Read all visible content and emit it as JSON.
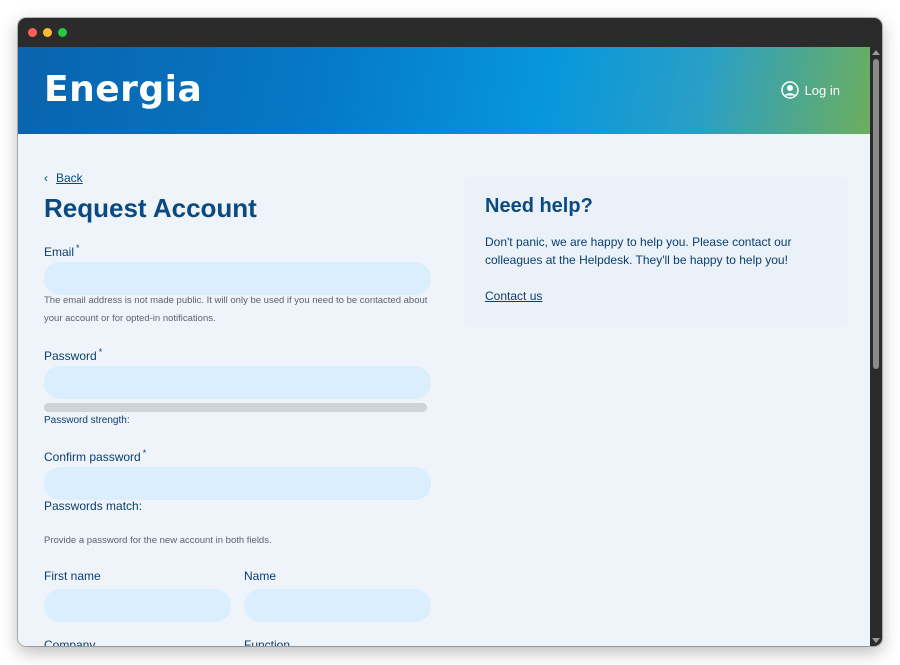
{
  "header": {
    "logo_text": "Energia",
    "login_label": "Log in"
  },
  "nav": {
    "back_label": "Back"
  },
  "page": {
    "title": "Request Account"
  },
  "form": {
    "email": {
      "label": "Email",
      "required_mark": "*",
      "value": "",
      "help": "The email address is not made public. It will only be used if you need to be contacted about your account or for opted-in notifications."
    },
    "password": {
      "label": "Password",
      "required_mark": "*",
      "value": "",
      "strength_label": "Password strength:"
    },
    "confirm_password": {
      "label": "Confirm password",
      "required_mark": "*",
      "value": "",
      "match_label": "Passwords match:",
      "help": "Provide a password for the new account in both fields."
    },
    "first_name": {
      "label": "First name",
      "value": ""
    },
    "name": {
      "label": "Name",
      "value": ""
    },
    "company": {
      "label": "Company"
    },
    "function": {
      "label": "Function"
    }
  },
  "help_panel": {
    "title": "Need help?",
    "body": "Don't panic, we are happy to help you. Please contact our colleagues at the Helpdesk. They'll be happy to help you!",
    "link": "Contact us"
  },
  "colors": {
    "brand_blue": "#0a4a80",
    "input_bg": "#dbeefe",
    "page_bg": "#eef4fa"
  }
}
